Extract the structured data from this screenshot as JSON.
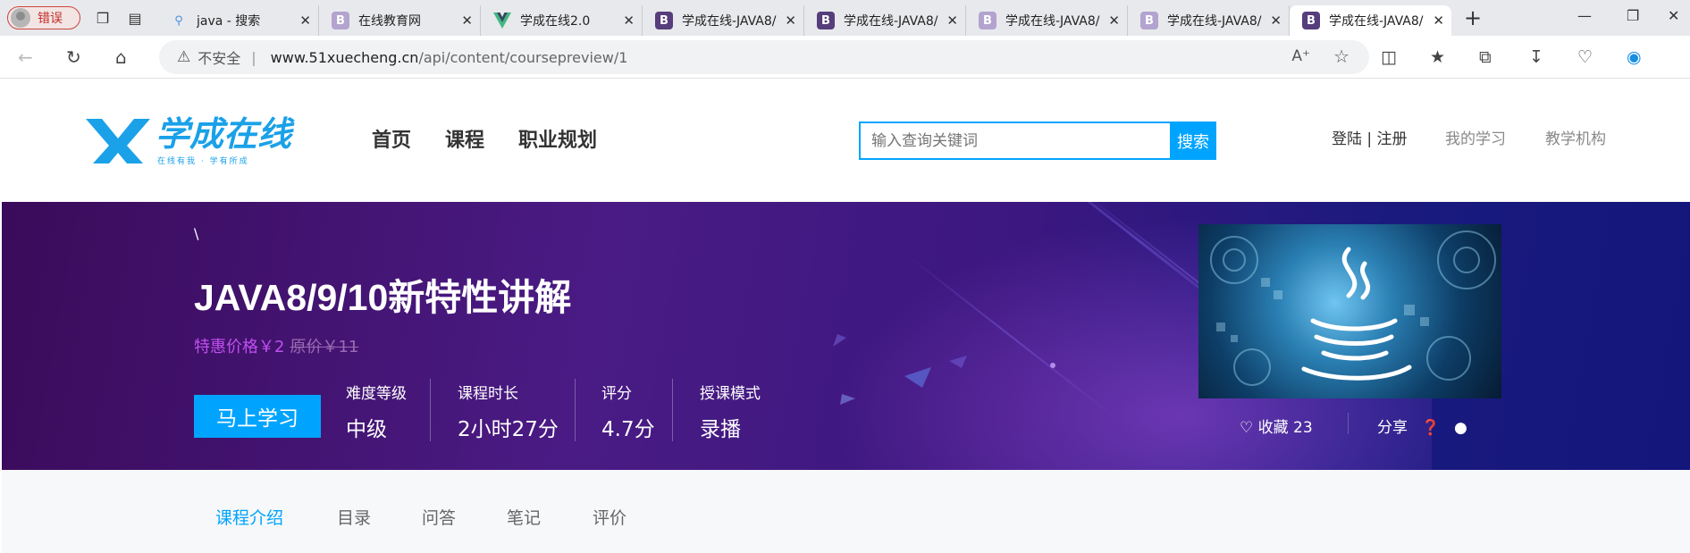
{
  "browser": {
    "profile_label": "错误",
    "tabs": [
      {
        "title": "java - 搜索",
        "favicon": "search-icon",
        "color": "#4a90e2"
      },
      {
        "title": "在线教育网",
        "favicon": "B",
        "color": "#b3a3cf"
      },
      {
        "title": "学成在线2.0",
        "favicon": "V",
        "color": "#42b883"
      },
      {
        "title": "学成在线-JAVA8/",
        "favicon": "B",
        "color": "#563d7c"
      },
      {
        "title": "学成在线-JAVA8/",
        "favicon": "B",
        "color": "#563d7c"
      },
      {
        "title": "学成在线-JAVA8/",
        "favicon": "B",
        "color": "#b3a3cf"
      },
      {
        "title": "学成在线-JAVA8/",
        "favicon": "B",
        "color": "#b3a3cf"
      },
      {
        "title": "学成在线-JAVA8/",
        "favicon": "B",
        "color": "#563d7c"
      }
    ],
    "address": {
      "security_label": "不安全",
      "host": "www.51xuecheng.cn",
      "path": "/api/content/coursepreview/1"
    }
  },
  "site": {
    "logo_text": "学成在线",
    "logo_tagline": "在线有我 · 学有所成",
    "nav": [
      "首页",
      "课程",
      "职业规划"
    ],
    "search": {
      "placeholder": "输入查询关键词",
      "button": "搜索"
    },
    "login": "登陆",
    "divider": "|",
    "register": "注册",
    "my_learning": "我的学习",
    "institution": "教学机构"
  },
  "course": {
    "breadcrumb": "\\",
    "title": "JAVA8/9/10新特性讲解",
    "price_label": "特惠价格￥2",
    "original_price": "原价￥11",
    "learn_button": "马上学习",
    "stats": [
      {
        "label": "难度等级",
        "value": "中级"
      },
      {
        "label": "课程时长",
        "value": "2小时27分"
      },
      {
        "label": "评分",
        "value": "4.7分"
      },
      {
        "label": "授课模式",
        "value": "录播"
      }
    ],
    "favorite_label": "收藏 23",
    "share_label": "分享"
  },
  "content_tabs": [
    "课程介绍",
    "目录",
    "问答",
    "笔记",
    "评价"
  ],
  "colors": {
    "accent": "#00a4ff",
    "price": "#c14ff0"
  }
}
